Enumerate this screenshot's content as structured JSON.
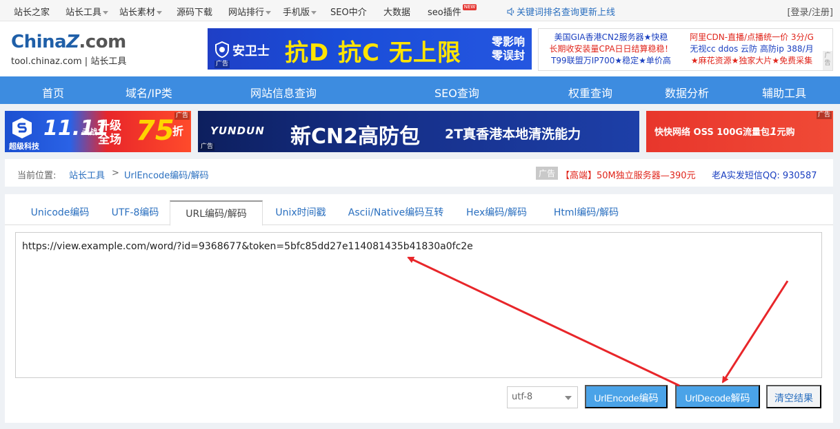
{
  "topbar": {
    "items": [
      "站长之家",
      "站长工具",
      "站长素材",
      "源码下载",
      "网站排行",
      "手机版",
      "SEO中介",
      "大数据",
      "seo插件"
    ],
    "new_badge": "NEW",
    "notice": "关键词排名查询更新上线",
    "login": "[登录/注册]"
  },
  "logo": {
    "main_prefix": "China",
    "main_z": "Z",
    "main_suffix": ".com",
    "sub": "tool.chinaz.com | 站长工具"
  },
  "banner_main": {
    "brand": "安卫士",
    "headline": "抗D 抗C 无上限",
    "right_line1": "零影响",
    "right_line2": "零误封",
    "ad_tag": "广告"
  },
  "text_ads": {
    "left": [
      "美国GIA香港CN2服务器★快稳",
      "长期收安装量CPA日日结算稳稳！",
      "T99联盟万IP700★稳定★单价高"
    ],
    "right": [
      "阿里CDN-直播/点播统一价 3分/G",
      "无视cc ddos 云防 高防ip 388/月",
      "★麻花资源★独家大片★免费采集"
    ],
    "ad_tag": "广告"
  },
  "mainnav": {
    "items": [
      "首页",
      "域名/IP类",
      "网站信息查询",
      "SEO查询",
      "权重查询",
      "数据分析",
      "辅助工具"
    ]
  },
  "ads": {
    "ad1": {
      "brand": "超级科技",
      "eleven": "11.11",
      "cloud": "云战",
      "upgrade_1": "升级",
      "upgrade_2": "全场",
      "num": "75",
      "zhe": "折",
      "tag": "广告"
    },
    "ad2": {
      "brand": "YUNDUN",
      "headline": "新CN2高防包",
      "sub": "2T真香港本地清洗能力",
      "tag": "广告"
    },
    "ad3": {
      "text_prefix": "快快网络 OSS 100G流量包",
      "text_num": "1",
      "text_suffix": "元购",
      "tag": "广告"
    }
  },
  "breadcrumb": {
    "label": "当前位置:",
    "home": "站长工具",
    "sep": ">",
    "current": "UrlEncode编码/解码",
    "ad_badge": "广告",
    "ad_text": "【高端】50M独立服务器—390元",
    "qq": "老A实发短信QQ: 930587"
  },
  "tabs": [
    "Unicode编码",
    "UTF-8编码",
    "URL编码/解码",
    "Unix时间戳",
    "Ascii/Native编码互转",
    "Hex编码/解码",
    "Html编码/解码"
  ],
  "active_tab_index": 2,
  "input": {
    "value": "https://view.example.com/word/?id=9368677&token=5bfc85dd27e114081435b41830a0fc2e"
  },
  "controls": {
    "charset": "utf-8",
    "encode_label": "UrlEncode编码",
    "decode_label": "UrlDecode解码",
    "clear_label": "清空结果"
  },
  "colors": {
    "accent": "#3d8ce0",
    "button": "#4aa3e8",
    "link": "#2a6fbf",
    "annotation_arrow": "#e8262a"
  }
}
